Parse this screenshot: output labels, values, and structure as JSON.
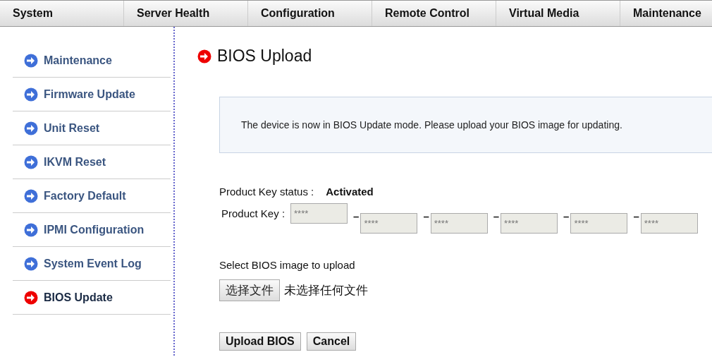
{
  "nav": [
    "System",
    "Server Health",
    "Configuration",
    "Remote Control",
    "Virtual Media",
    "Maintenance"
  ],
  "sidebar": {
    "items": [
      {
        "label": "Maintenance",
        "selected": false
      },
      {
        "label": "Firmware Update",
        "selected": false
      },
      {
        "label": "Unit Reset",
        "selected": false
      },
      {
        "label": "IKVM Reset",
        "selected": false
      },
      {
        "label": "Factory Default",
        "selected": false
      },
      {
        "label": "IPMI Configuration",
        "selected": false
      },
      {
        "label": "System Event Log",
        "selected": false
      },
      {
        "label": "BIOS Update",
        "selected": true
      }
    ]
  },
  "title": "BIOS Upload",
  "notice": "The device is now in BIOS Update mode. Please upload your BIOS image for updating.",
  "key_status": {
    "label": "Product Key status :",
    "value": "Activated"
  },
  "product_key": {
    "label": "Product Key :",
    "separator": "–",
    "fields": [
      {
        "placeholder": "****"
      },
      {
        "placeholder": "****"
      },
      {
        "placeholder": "****"
      },
      {
        "placeholder": "****"
      },
      {
        "placeholder": "****"
      },
      {
        "placeholder": "****"
      }
    ]
  },
  "file": {
    "label": "Select BIOS image to upload",
    "button": "选择文件",
    "status": "未选择任何文件"
  },
  "buttons": [
    "Upload BIOS",
    "Cancel"
  ]
}
